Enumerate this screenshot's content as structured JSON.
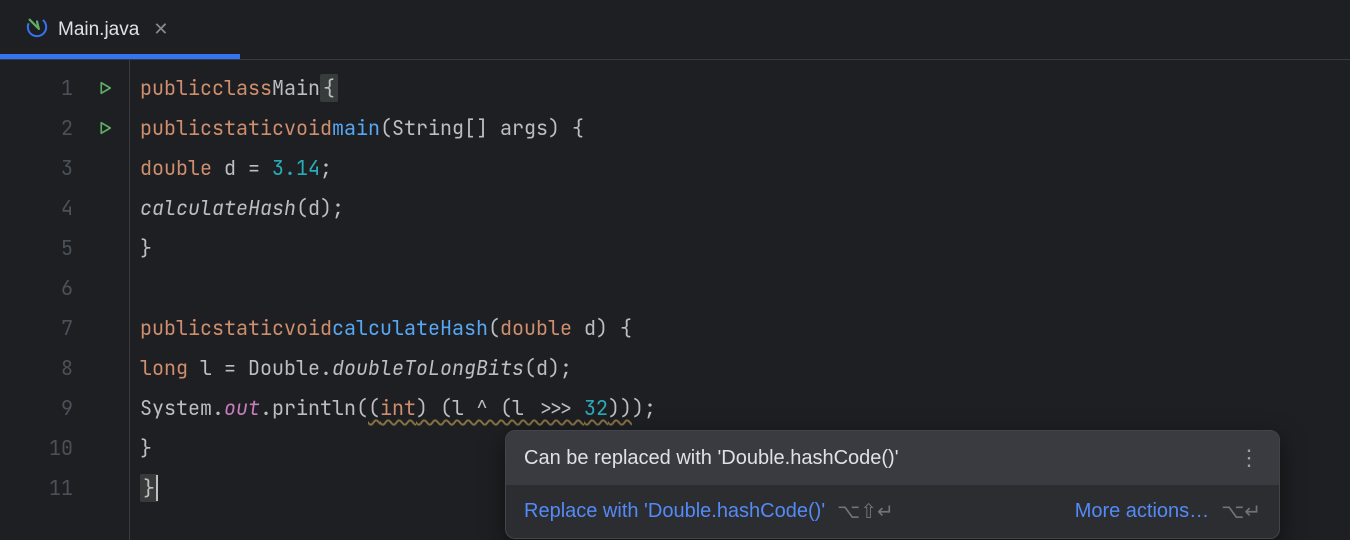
{
  "tab": {
    "label": "Main.java"
  },
  "gutter": {
    "lines": [
      "1",
      "2",
      "3",
      "4",
      "5",
      "6",
      "7",
      "8",
      "9",
      "10",
      "11"
    ],
    "runLines": [
      1,
      2
    ]
  },
  "code": {
    "l1": {
      "kw1": "public",
      "kw2": "class",
      "cls": "Main",
      "brace": "{"
    },
    "l2": {
      "kw1": "public",
      "kw2": "static",
      "kw3": "void",
      "mtd": "main",
      "params": "(String[] args) {"
    },
    "l3": {
      "kw": "double",
      "var": " d = ",
      "num": "3.14",
      "semi": ";"
    },
    "l4": {
      "mtd": "calculateHash",
      "args": "(d);"
    },
    "l5": {
      "brace": "}"
    },
    "l7": {
      "kw1": "public",
      "kw2": "static",
      "kw3": "void",
      "mtd": "calculateHash",
      "params": "(",
      "pkw": "double",
      "pend": " d) {"
    },
    "l8": {
      "kw": "long",
      "var": " l = Double.",
      "smtd": "doubleToLongBits",
      "args": "(d);"
    },
    "l9": {
      "pre": "System.",
      "fld": "out",
      "call": ".println(",
      "w1": "(",
      "cast": "int",
      "w2": ") (l ^ (l >>> ",
      "num": "32",
      "w3": "))",
      "end": ");"
    },
    "l10": {
      "brace": "}"
    },
    "l11": {
      "brace": "}"
    }
  },
  "popup": {
    "title": "Can be replaced with 'Double.hashCode()'",
    "action": "Replace with 'Double.hashCode()'",
    "shortcut1": "⌥⇧↵",
    "moreActions": "More actions…",
    "shortcut2": "⌥↵"
  }
}
